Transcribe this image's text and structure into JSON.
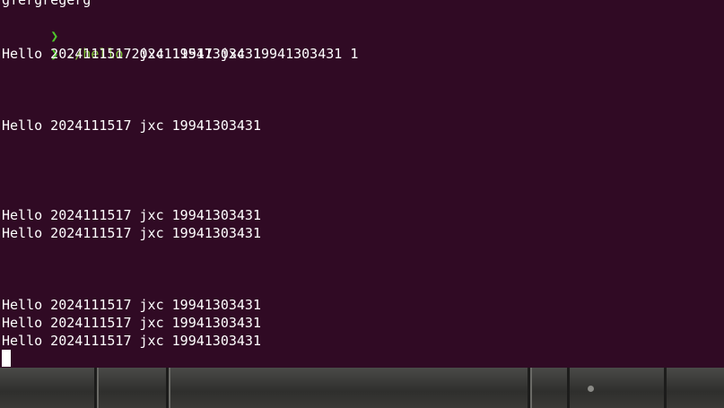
{
  "terminal": {
    "top_text": "gfergregerg",
    "prompt_symbol": "❯",
    "command_program": "./hello",
    "command_args": " 2024111517 jxc 19941303431 1",
    "output_lines": [
      "Hello 2024111517 jxc 19941303431",
      "Hello 2024111517 jxc 19941303431",
      "Hello 2024111517 jxc 19941303431",
      "Hello 2024111517 jxc 19941303431",
      "Hello 2024111517 jxc 19941303431",
      "Hello 2024111517 jxc 19941303431",
      "Hello 2024111517 jxc 19941303431"
    ]
  },
  "colors": {
    "terminal_background": "#300a24",
    "prompt_green": "#4ec72b",
    "command_green": "#7fc43a",
    "text": "#ffffff"
  }
}
